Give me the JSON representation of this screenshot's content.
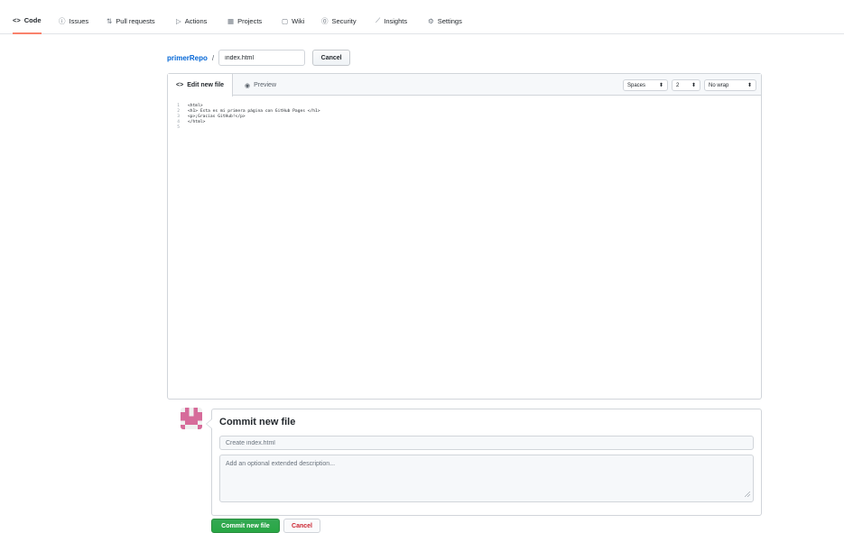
{
  "repo_nav": {
    "tabs": [
      {
        "label": "Code",
        "icon": "code-icon",
        "glyph": "<>"
      },
      {
        "label": "Issues",
        "icon": "issue-icon",
        "glyph": "ⓘ"
      },
      {
        "label": "Pull requests",
        "icon": "pull-request-icon",
        "glyph": "⇅"
      },
      {
        "label": "Actions",
        "icon": "play-icon",
        "glyph": "▷"
      },
      {
        "label": "Projects",
        "icon": "project-icon",
        "glyph": "▦"
      },
      {
        "label": "Wiki",
        "icon": "book-icon",
        "glyph": "▢"
      },
      {
        "label": "Security",
        "icon": "shield-icon",
        "glyph": "⓪"
      },
      {
        "label": "Insights",
        "icon": "graph-icon",
        "glyph": "⟋"
      },
      {
        "label": "Settings",
        "icon": "gear-icon",
        "glyph": "⚙"
      }
    ],
    "active_tab": "Code",
    "accent_color": "#f9826c"
  },
  "breadcrumb": {
    "repo": "primerRepo",
    "separator": "/",
    "filename_value": "index.html",
    "cancel_label": "Cancel"
  },
  "editor": {
    "tabs": {
      "edit": {
        "label": "Edit new file",
        "icon": "code-icon",
        "glyph": "<>"
      },
      "preview": {
        "label": "Preview",
        "icon": "eye-icon",
        "glyph": "◉"
      }
    },
    "indent_mode": "Spaces",
    "indent_size": "2",
    "wrap_mode": "No wrap",
    "lines": [
      {
        "n": "1",
        "text": "<html>"
      },
      {
        "n": "2",
        "text": "<h1> Esta es mi primera página con GitHub Pages </h1>"
      },
      {
        "n": "3",
        "text": "<p>¡Gracias GitHub!</p>"
      },
      {
        "n": "4",
        "text": "</html>"
      },
      {
        "n": "5",
        "text": ""
      }
    ]
  },
  "commit": {
    "title": "Commit new file",
    "message_placeholder": "Create index.html",
    "description_placeholder": "Add an optional extended description...",
    "commit_label": "Commit new file",
    "cancel_label": "Cancel",
    "commit_color": "#28a745",
    "cancel_color": "#cb2431"
  }
}
